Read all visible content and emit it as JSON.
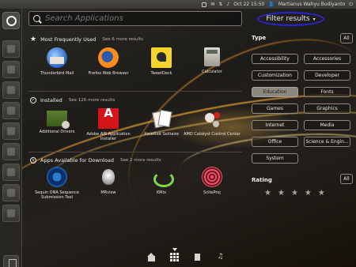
{
  "top_panel": {
    "datetime": "Oct 22 15:50",
    "user": "Martianus Wahyu Budiyanto"
  },
  "search": {
    "placeholder": "Search Applications"
  },
  "filter": {
    "label": "Filter results",
    "caret": "▾"
  },
  "sections": [
    {
      "title": "Most Frequently Used",
      "more": "See 6 more results",
      "icon": "star-icon",
      "apps": [
        {
          "label": "Thunderbird Mail",
          "icon": "thunderbird-icon"
        },
        {
          "label": "Firefox Web Browser",
          "icon": "firefox-icon"
        },
        {
          "label": "TweetDeck",
          "icon": "tweetdeck-icon"
        },
        {
          "label": "Calculator",
          "icon": "calculator-icon"
        }
      ]
    },
    {
      "title": "Installed",
      "more": "See 126 more results",
      "icon": "check-icon",
      "apps": [
        {
          "label": "Additional Drivers",
          "icon": "drivers-icon"
        },
        {
          "label": "Adobe AIR Application Installer",
          "icon": "adobe-air-icon"
        },
        {
          "label": "AisleRiot Solitaire",
          "icon": "solitaire-icon"
        },
        {
          "label": "AMD Catalyst Control Center",
          "icon": "amd-catalyst-icon"
        }
      ]
    },
    {
      "title": "Apps Available for Download",
      "more": "See 2 more results",
      "icon": "download-icon",
      "apps": [
        {
          "label": "Sequin DNA Sequence Submission Tool",
          "icon": "sequin-icon"
        },
        {
          "label": "MRview",
          "icon": "mrview-icon"
        },
        {
          "label": "KMix",
          "icon": "kmix-icon"
        },
        {
          "label": "SciteProj",
          "icon": "sciteproj-icon"
        }
      ]
    }
  ],
  "type_panel": {
    "title": "Type",
    "all_label": "All",
    "buttons": [
      {
        "label": "Accessibility",
        "active": false
      },
      {
        "label": "Accessories",
        "active": false
      },
      {
        "label": "Customization",
        "active": false
      },
      {
        "label": "Developer",
        "active": false
      },
      {
        "label": "Education",
        "active": true
      },
      {
        "label": "Fonts",
        "active": false
      },
      {
        "label": "Games",
        "active": false
      },
      {
        "label": "Graphics",
        "active": false
      },
      {
        "label": "Internet",
        "active": false
      },
      {
        "label": "Media",
        "active": false
      },
      {
        "label": "Office",
        "active": false
      },
      {
        "label": "Science & Engin...",
        "active": false
      },
      {
        "label": "System",
        "active": false
      }
    ]
  },
  "rating_panel": {
    "title": "Rating",
    "all_label": "All",
    "stars": 5,
    "star_glyph": "★"
  },
  "colors": {
    "accent_highlight": "#2a24d6",
    "active_filter_bg": "#8c8880"
  }
}
